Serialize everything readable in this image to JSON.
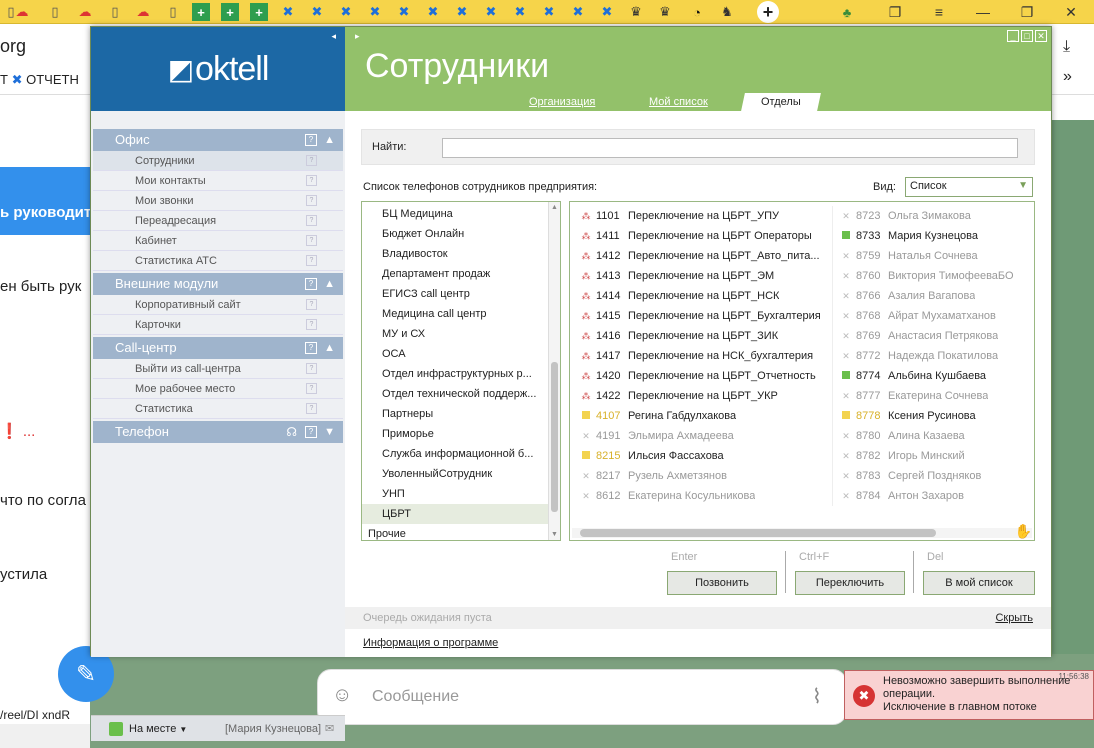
{
  "browser": {
    "bg_url": "org",
    "bg_bookmark": "Т",
    "bg_bookmark2": "ОТЧЕТН",
    "messages": [
      "ь руководит",
      "ен быть рук",
      "❗ ...",
      "что по согла",
      "устила"
    ],
    "compose_placeholder": "Сообщение",
    "bottom_url": "/reel/DI xndR"
  },
  "app": {
    "logo": "oktell",
    "title": "Сотрудники",
    "tabs": [
      "Организация",
      "Мой список",
      "Отделы"
    ],
    "active_tab": "Отделы"
  },
  "sidebar": {
    "sections": [
      {
        "label": "Офис",
        "items": [
          "Сотрудники",
          "Мои контакты",
          "Мои звонки",
          "Переадресация",
          "Кабинет",
          "Статистика АТС"
        ]
      },
      {
        "label": "Внешние модули",
        "items": [
          "Корпоративный сайт",
          "Карточки"
        ]
      },
      {
        "label": "Call-центр",
        "items": [
          "Выйти из call-центра",
          "Мое рабочее место",
          "Статистика"
        ]
      },
      {
        "label": "Телефон",
        "items": []
      }
    ],
    "status": "На месте",
    "user": "[Мария Кузнецова]"
  },
  "main": {
    "search_label": "Найти:",
    "list_caption": "Список телефонов сотрудников предприятия:",
    "view_label": "Вид:",
    "view_value": "Список",
    "departments": [
      "БЦ Медицина",
      "Бюджет Онлайн",
      "Владивосток",
      "Департамент продаж",
      "ЕГИСЗ call центр",
      "Медицина call центр",
      "МУ и СХ",
      "ОСА",
      "Отдел инфраструктурных р...",
      "Отдел технической поддерж...",
      "Партнеры",
      "Приморье",
      "Служба информационной б...",
      "УволенныйСотрудник",
      "УНП",
      "ЦБРТ",
      "Прочие"
    ],
    "selected_department": "ЦБРТ",
    "employees_left": [
      {
        "num": "1101",
        "name": "Переключение на ЦБРТ_УПУ",
        "state": "queue"
      },
      {
        "num": "1411",
        "name": "Переключение на ЦБРТ Операторы",
        "state": "queue"
      },
      {
        "num": "1412",
        "name": "Переключение на ЦБРТ_Авто_пита...",
        "state": "queue"
      },
      {
        "num": "1413",
        "name": "Переключение на ЦБРТ_ЭМ",
        "state": "queue"
      },
      {
        "num": "1414",
        "name": "Переключение на ЦБРТ_НСК",
        "state": "queue"
      },
      {
        "num": "1415",
        "name": "Переключение на ЦБРТ_Бухгалтерия",
        "state": "queue"
      },
      {
        "num": "1416",
        "name": "Переключение на ЦБРТ_ЗИК",
        "state": "queue"
      },
      {
        "num": "1417",
        "name": "Переключение на НСК_бухгалтерия",
        "state": "queue"
      },
      {
        "num": "1420",
        "name": "Переключение на ЦБРТ_Отчетность",
        "state": "queue"
      },
      {
        "num": "1422",
        "name": "Переключение на ЦБРТ_УКР",
        "state": "queue"
      },
      {
        "num": "4107",
        "name": "Регина Габдулхакова",
        "state": "away"
      },
      {
        "num": "4191",
        "name": "Эльмира Ахмадеева",
        "state": "off"
      },
      {
        "num": "8215",
        "name": "Ильсия Фассахова",
        "state": "away"
      },
      {
        "num": "8217",
        "name": "Рузель Ахметзянов",
        "state": "off"
      },
      {
        "num": "8612",
        "name": "Екатерина Косульникова",
        "state": "off"
      }
    ],
    "employees_right": [
      {
        "num": "8723",
        "name": "Ольга Зимакова",
        "state": "off"
      },
      {
        "num": "8733",
        "name": "Мария Кузнецова",
        "state": "online"
      },
      {
        "num": "8759",
        "name": "Наталья Сочнева",
        "state": "off"
      },
      {
        "num": "8760",
        "name": "Виктория ТимофееваБО",
        "state": "off"
      },
      {
        "num": "8766",
        "name": "Азалия Вагапова",
        "state": "off"
      },
      {
        "num": "8768",
        "name": "Айрат Мухаматханов",
        "state": "off"
      },
      {
        "num": "8769",
        "name": "Анастасия Петрякова",
        "state": "off"
      },
      {
        "num": "8772",
        "name": "Надежда Покатилова",
        "state": "off"
      },
      {
        "num": "8774",
        "name": "Альбина Кушбаева",
        "state": "online"
      },
      {
        "num": "8777",
        "name": "Екатерина Сочнева",
        "state": "off"
      },
      {
        "num": "8778",
        "name": "Ксения Русинова",
        "state": "away"
      },
      {
        "num": "8780",
        "name": "Алина Казаева",
        "state": "off"
      },
      {
        "num": "8782",
        "name": "Игорь Минский",
        "state": "off"
      },
      {
        "num": "8783",
        "name": "Сергей Поздняков",
        "state": "off"
      },
      {
        "num": "8784",
        "name": "Антон Захаров",
        "state": "off"
      }
    ],
    "hotkeys": [
      "Enter",
      "Ctrl+F",
      "Del"
    ],
    "buttons": [
      "Позвонить",
      "Переключить",
      "В мой список"
    ],
    "queue_text": "Очередь ожидания пуста",
    "hide_link": "Скрыть",
    "about_link": "Информация о программе"
  },
  "error": {
    "time": "11:56:38",
    "line1": "Невозможно завершить выполнение",
    "line2": "операции.",
    "line3": "Исключение в главном потоке"
  },
  "colors": {
    "accent_green": "#93c16a",
    "brand_blue": "#1c68a5",
    "online": "#6abf4b",
    "away": "#f3d34f",
    "error": "#d63333"
  }
}
